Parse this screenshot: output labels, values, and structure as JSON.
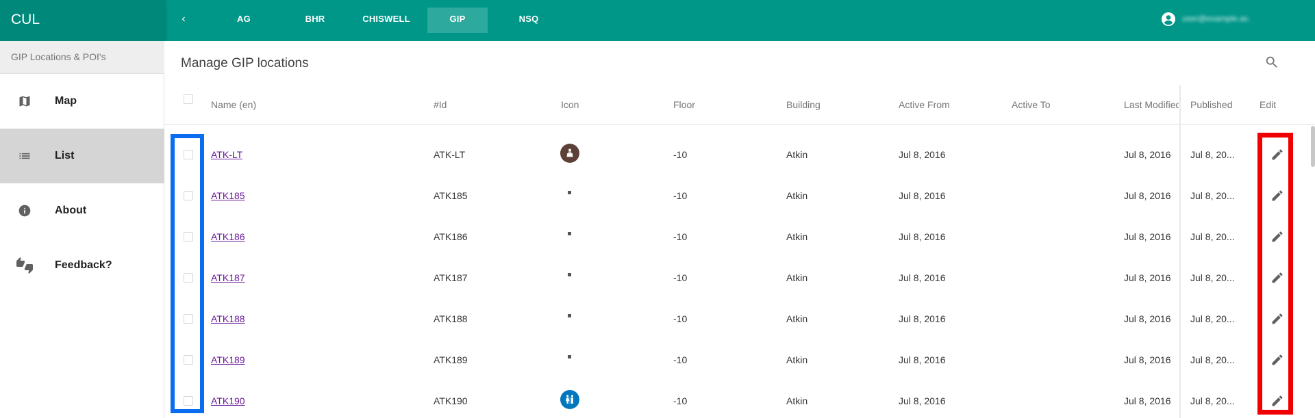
{
  "app": {
    "brand": "CUL"
  },
  "nav": {
    "tabs": [
      {
        "label": "AG",
        "active": false
      },
      {
        "label": "BHR",
        "active": false
      },
      {
        "label": "CHISWELL",
        "active": false
      },
      {
        "label": "GIP",
        "active": true
      },
      {
        "label": "NSQ",
        "active": false
      }
    ],
    "account_name": "user@example.ac.uk"
  },
  "sidebar": {
    "header": "GIP Locations & POI's",
    "items": [
      {
        "label": "Map",
        "icon": "map-icon",
        "active": false
      },
      {
        "label": "List",
        "icon": "list-icon",
        "active": true
      },
      {
        "label": "About",
        "icon": "info-icon",
        "active": false
      },
      {
        "label": "Feedback?",
        "icon": "thumbs-icon",
        "active": false
      }
    ]
  },
  "main": {
    "title": "Manage GIP locations",
    "table": {
      "columns": [
        "Name (en)",
        "#Id",
        "Icon",
        "Floor",
        "Building",
        "Active From",
        "Active To",
        "Last Modified",
        "Published",
        "Edit"
      ],
      "rows": [
        {
          "name": "ATK-LT",
          "id": "ATK-LT",
          "icon": "lecture-theatre-icon",
          "floor": "-10",
          "building": "Atkin",
          "active_from": "Jul 8, 2016",
          "active_to": "",
          "last_modified": "Jul 8, 2016",
          "published": "Jul 8, 20..."
        },
        {
          "name": "ATK185",
          "id": "ATK185",
          "icon": "room-dot-icon",
          "floor": "-10",
          "building": "Atkin",
          "active_from": "Jul 8, 2016",
          "active_to": "",
          "last_modified": "Jul 8, 2016",
          "published": "Jul 8, 20..."
        },
        {
          "name": "ATK186",
          "id": "ATK186",
          "icon": "room-dot-icon",
          "floor": "-10",
          "building": "Atkin",
          "active_from": "Jul 8, 2016",
          "active_to": "",
          "last_modified": "Jul 8, 2016",
          "published": "Jul 8, 20..."
        },
        {
          "name": "ATK187",
          "id": "ATK187",
          "icon": "room-dot-icon",
          "floor": "-10",
          "building": "Atkin",
          "active_from": "Jul 8, 2016",
          "active_to": "",
          "last_modified": "Jul 8, 2016",
          "published": "Jul 8, 20..."
        },
        {
          "name": "ATK188",
          "id": "ATK188",
          "icon": "room-dot-icon",
          "floor": "-10",
          "building": "Atkin",
          "active_from": "Jul 8, 2016",
          "active_to": "",
          "last_modified": "Jul 8, 2016",
          "published": "Jul 8, 20..."
        },
        {
          "name": "ATK189",
          "id": "ATK189",
          "icon": "room-dot-icon",
          "floor": "-10",
          "building": "Atkin",
          "active_from": "Jul 8, 2016",
          "active_to": "",
          "last_modified": "Jul 8, 2016",
          "published": "Jul 8, 20..."
        },
        {
          "name": "ATK190",
          "id": "ATK190",
          "icon": "toilets-icon",
          "floor": "-10",
          "building": "Atkin",
          "active_from": "Jul 8, 2016",
          "active_to": "",
          "last_modified": "Jul 8, 2016",
          "published": "Jul 8, 20..."
        }
      ]
    }
  },
  "colors": {
    "primary": "#009688",
    "primary_dark": "#00897b",
    "link": "#6a1b9a",
    "highlight_blue": "#0a6df0",
    "highlight_red": "#f00000",
    "lecture_icon_bg": "#5d4037",
    "toilets_icon_bg": "#0277bd"
  }
}
